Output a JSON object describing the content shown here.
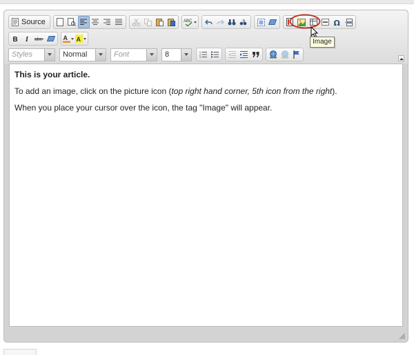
{
  "toolbar": {
    "source_label": "Source"
  },
  "combos": {
    "styles": "Styles",
    "format": "Normal",
    "font": "Font",
    "size": "8"
  },
  "tooltip": {
    "text": "Image"
  },
  "content": {
    "heading": "This is your article.",
    "p1_before": "To add an image, click on the picture icon (",
    "p1_italic": "top right hand corner, 5th icon from the right",
    "p1_after": ").",
    "p2": "When you place your cursor over the icon, the tag \"Image\" will appear."
  },
  "colors": {
    "highlight_ring": "#c0392b",
    "active_button": "#a9c3e4",
    "toolbar_bg": "#e4e4e4"
  }
}
